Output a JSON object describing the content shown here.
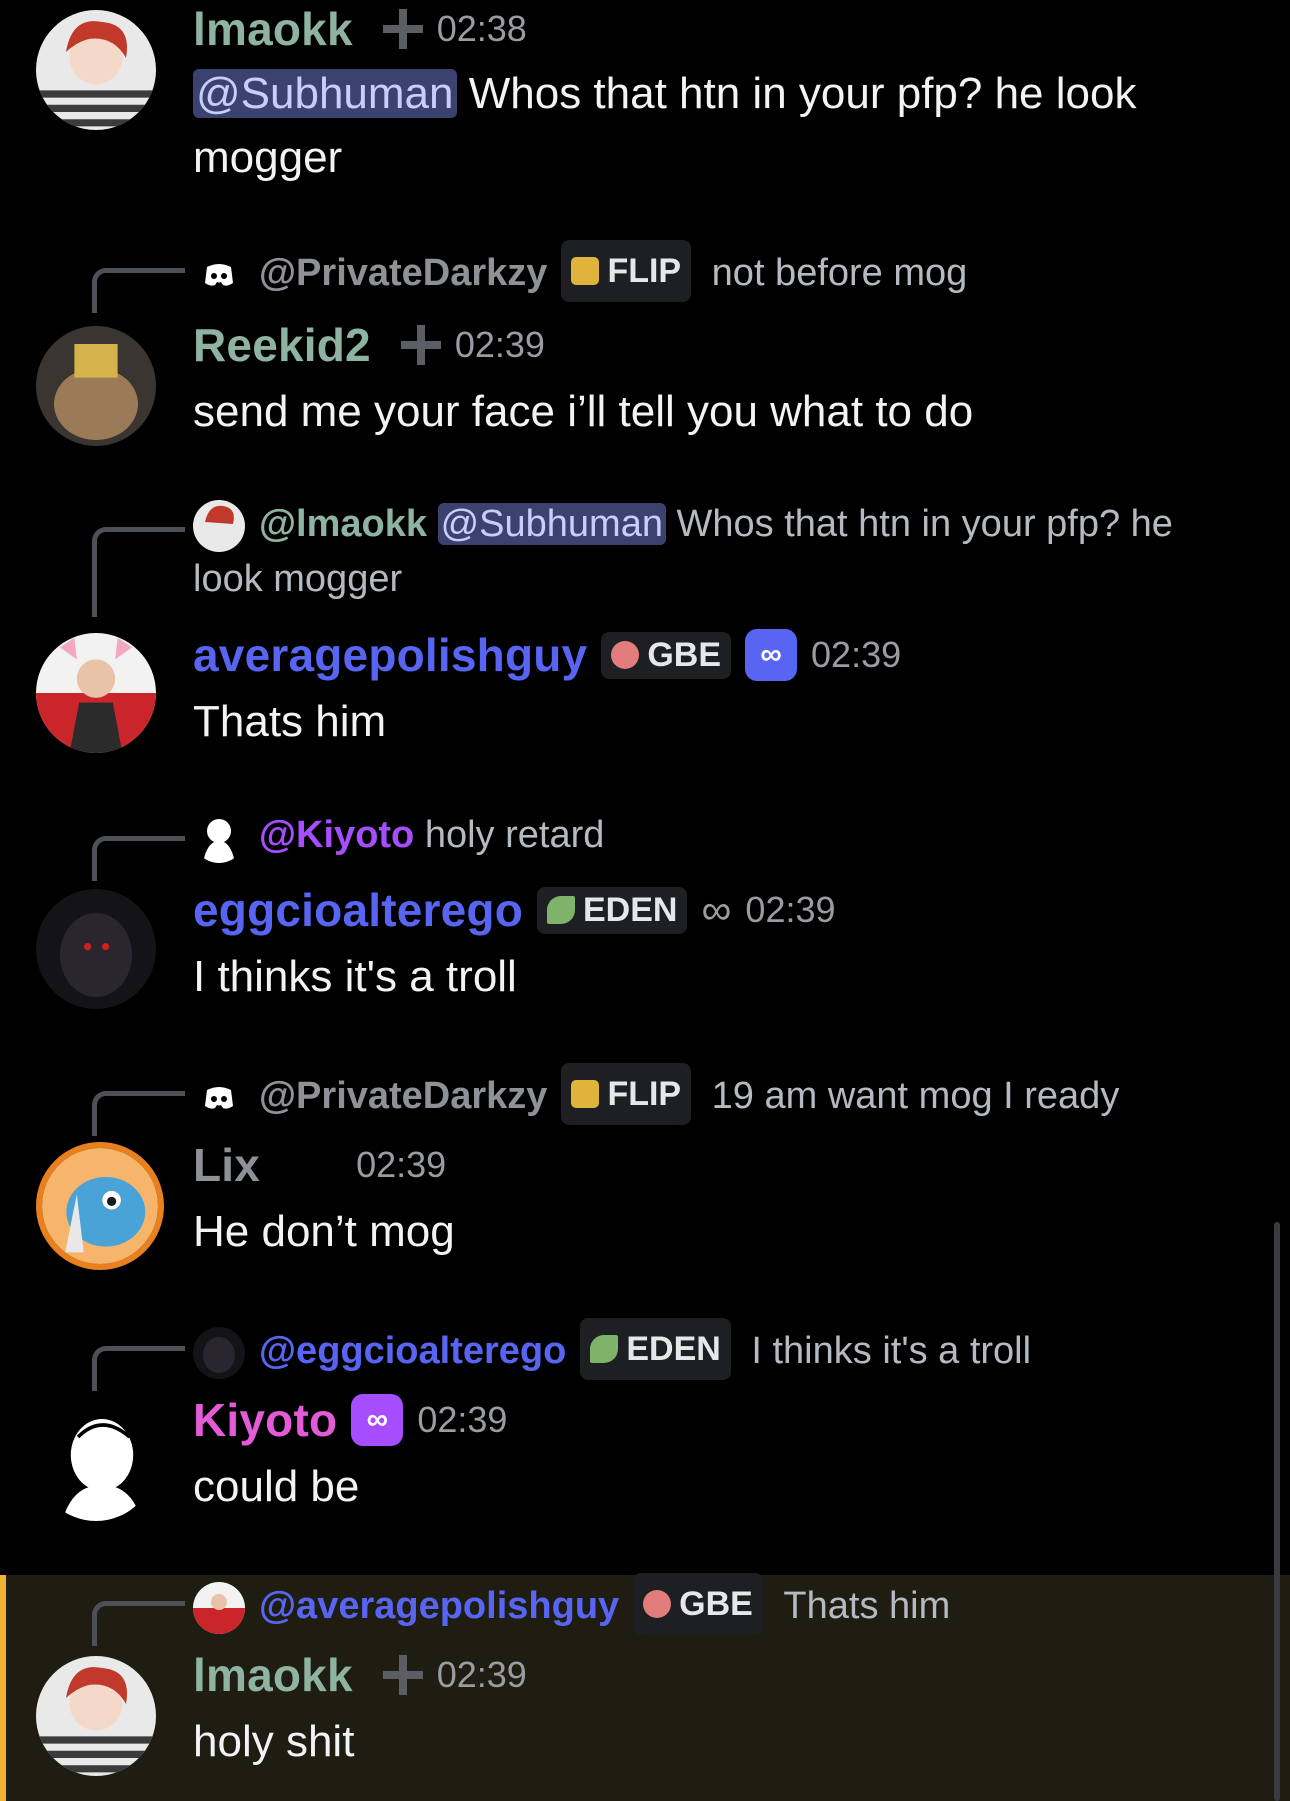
{
  "colors": {
    "green_name": "#8fb3a2",
    "blue_name": "#5865f2",
    "purple_name": "#a64dff",
    "pink_name": "#e35bd6",
    "grey_name": "#8e9297",
    "mention_bg": "#3c4270",
    "highlight_bar": "#f0b232"
  },
  "messages": [
    {
      "username": "lmaokk",
      "timestamp": "02:38",
      "mention": "@Subhuman",
      "text": "Whos that htn in your pfp? he look mogger"
    },
    {
      "reply": {
        "username": "@PrivateDarkzy",
        "tag": "FLIP",
        "text": "not before mog"
      },
      "username": "Reekid2",
      "timestamp": "02:39",
      "text": "send me your face i’ll tell you what to do"
    },
    {
      "reply": {
        "username": "@lmaokk",
        "mention": "@Subhuman",
        "text": "Whos that htn in your pfp? he look mogger"
      },
      "username": "averagepolishguy",
      "tag": "GBE",
      "badge_icon": "infinity-support-icon",
      "timestamp": "02:39",
      "text": "Thats him"
    },
    {
      "reply": {
        "username": "@Kiyoto",
        "text": "holy retard"
      },
      "username": "eggcioalterego",
      "tag": "EDEN",
      "timestamp": "02:39",
      "text": "I thinks it's a troll"
    },
    {
      "reply": {
        "username": "@PrivateDarkzy",
        "tag": "FLIP",
        "text": "19 am want mog I ready"
      },
      "username": "Lix",
      "timestamp": "02:39",
      "text": "He don’t mog"
    },
    {
      "reply": {
        "username": "@eggcioalterego",
        "tag": "EDEN",
        "text": "I thinks it's a troll"
      },
      "username": "Kiyoto",
      "timestamp": "02:39",
      "text": "could be"
    },
    {
      "reply": {
        "username": "@averagepolishguy",
        "tag": "GBE",
        "text": "Thats him"
      },
      "username": "lmaokk",
      "timestamp": "02:39",
      "text": "holy shit"
    }
  ]
}
